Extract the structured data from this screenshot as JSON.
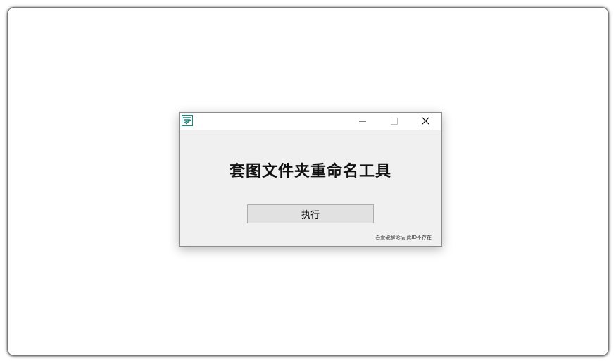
{
  "window": {
    "app_icon": "app-logo-icon",
    "title": "套图文件夹重命名工具",
    "controls": {
      "minimize_icon": "minimize-icon",
      "maximize_icon": "maximize-icon",
      "close_icon": "close-icon"
    },
    "execute_button_label": "执行",
    "footer_note": "吾爱破解论坛 此ID不存在"
  },
  "colors": {
    "window_body": "#f0f0f0",
    "titlebar": "#ffffff",
    "button_face": "#e1e1e1",
    "icon_teal": "#1a8a7a"
  }
}
